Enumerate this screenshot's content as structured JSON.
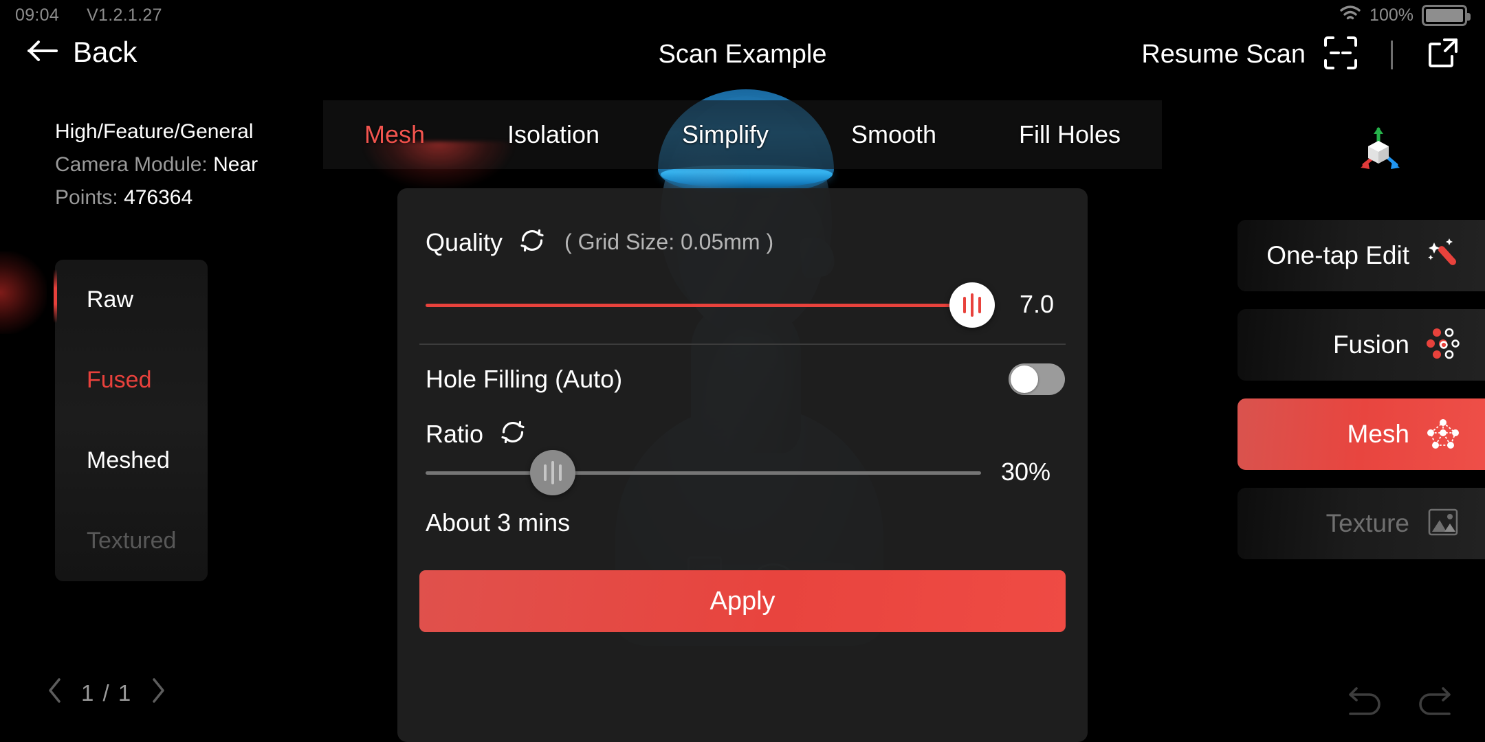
{
  "status_bar": {
    "time": "09:04",
    "version": "V1.2.1.27",
    "battery_percent": "100%",
    "wifi_icon": "wifi-icon",
    "battery_icon": "battery-icon"
  },
  "header": {
    "back_label": "Back",
    "back_icon": "arrow-left-icon",
    "title": "Scan Example",
    "resume_label": "Resume Scan",
    "scan_icon": "scan-frame-icon",
    "share_icon": "share-external-icon"
  },
  "scan_info": {
    "preset": "High/Feature/General",
    "camera_module_label": "Camera Module:",
    "camera_module_value": "Near",
    "points_label": "Points:",
    "points_value": "476364"
  },
  "stage_list": {
    "items": [
      {
        "label": "Raw",
        "state": "normal"
      },
      {
        "label": "Fused",
        "state": "active"
      },
      {
        "label": "Meshed",
        "state": "normal"
      },
      {
        "label": "Textured",
        "state": "disabled"
      }
    ]
  },
  "pager": {
    "prev_icon": "chevron-left-icon",
    "next_icon": "chevron-right-icon",
    "text": "1 / 1"
  },
  "tabs": {
    "items": [
      {
        "label": "Mesh",
        "active": true
      },
      {
        "label": "Isolation",
        "active": false
      },
      {
        "label": "Simplify",
        "active": false
      },
      {
        "label": "Smooth",
        "active": false
      },
      {
        "label": "Fill Holes",
        "active": false
      }
    ]
  },
  "panel": {
    "quality": {
      "label": "Quality",
      "reset_icon": "refresh-icon",
      "grid_size_text": "( Grid Size: 0.05mm )",
      "value": "7.0",
      "slider_percent": 100,
      "thumb_icon": "slider-handle-icon"
    },
    "hole_filling": {
      "label": "Hole Filling (Auto)",
      "enabled": false
    },
    "ratio": {
      "label": "Ratio",
      "reset_icon": "refresh-icon",
      "value": "30%",
      "slider_percent": 23,
      "disabled": true
    },
    "eta": "About 3 mins",
    "apply_label": "Apply"
  },
  "right_tools": {
    "axis_gizmo_icon": "axis-gizmo-icon",
    "buttons": [
      {
        "label": "One-tap Edit",
        "icon": "magic-wand-icon",
        "state": "normal"
      },
      {
        "label": "Fusion",
        "icon": "fusion-dots-icon",
        "state": "normal"
      },
      {
        "label": "Mesh",
        "icon": "mesh-network-icon",
        "state": "active"
      },
      {
        "label": "Texture",
        "icon": "image-icon",
        "state": "disabled"
      }
    ],
    "undo_icon": "undo-icon",
    "redo_icon": "redo-icon"
  },
  "colors": {
    "accent_red": "#e8423c",
    "panel_bg": "#202020",
    "disabled_gray": "#6f6f6f",
    "axis_x": "#e03b3b",
    "axis_y": "#26b24a",
    "axis_z": "#2196f3"
  }
}
